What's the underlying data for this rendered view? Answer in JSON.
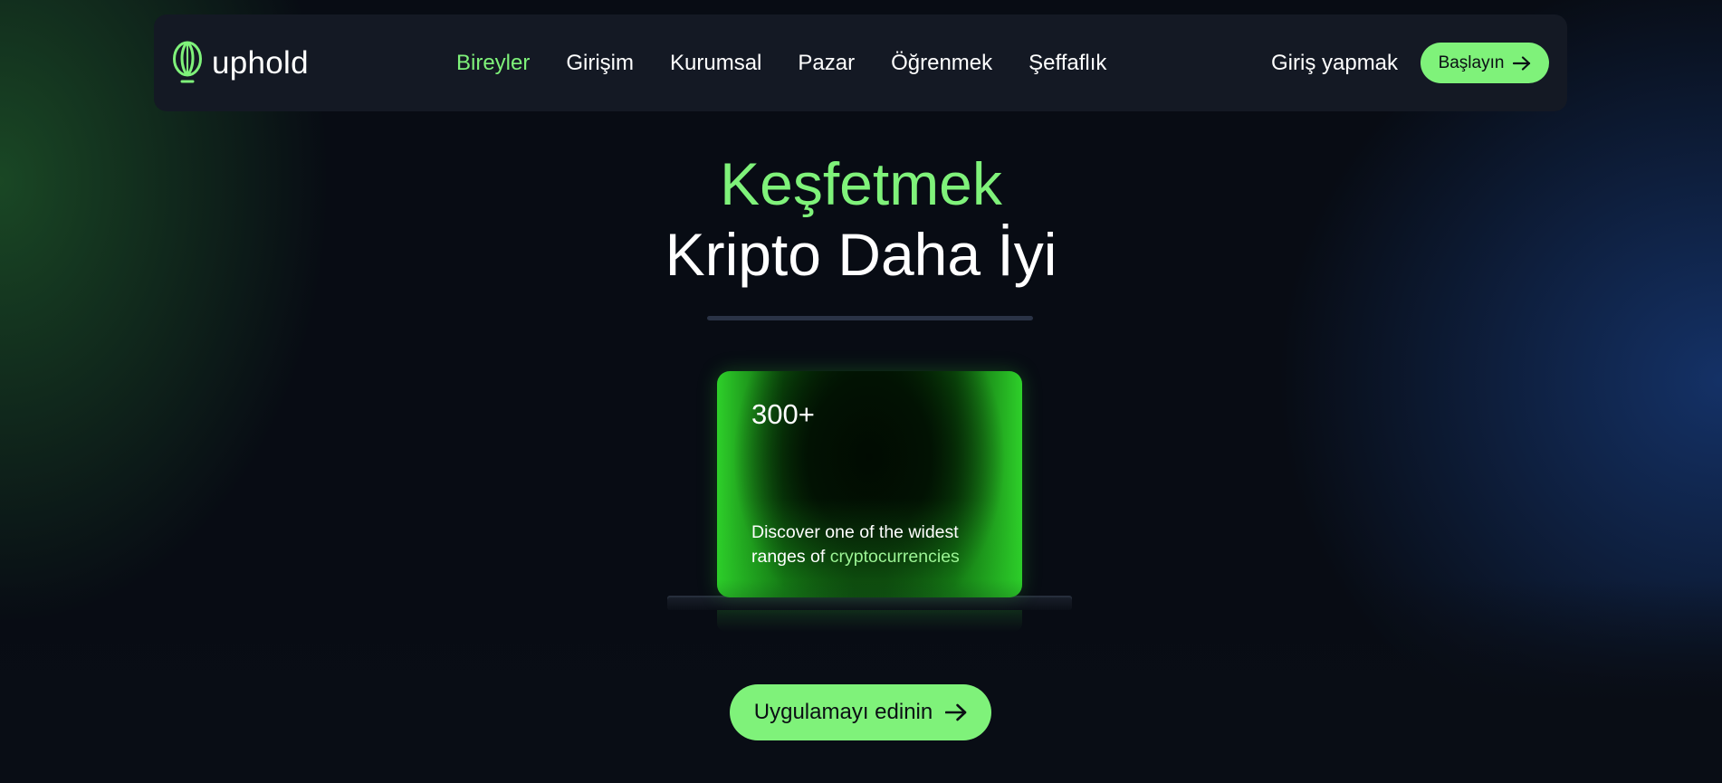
{
  "brand": {
    "name": "uphold",
    "logo_icon": "uphold-logo-icon",
    "accent_color": "#7ff27a"
  },
  "nav": {
    "items": [
      {
        "label": "Bireyler",
        "active": true
      },
      {
        "label": "Girişim",
        "active": false
      },
      {
        "label": "Kurumsal",
        "active": false
      },
      {
        "label": "Pazar",
        "active": false
      },
      {
        "label": "Öğrenmek",
        "active": false
      },
      {
        "label": "Şeffaflık",
        "active": false
      }
    ],
    "signin_label": "Giriş yapmak",
    "start_label": "Başlayın",
    "start_icon": "arrow-right-icon"
  },
  "hero": {
    "title_line1": "Keşfetmek",
    "title_line2": "Kripto Daha İyi"
  },
  "card": {
    "number": "300+",
    "desc_prefix": "Discover one of the widest ranges of ",
    "desc_highlight": "cryptocurrencies"
  },
  "cta": {
    "label": "Uygulamayı edinin",
    "icon": "arrow-right-icon"
  }
}
